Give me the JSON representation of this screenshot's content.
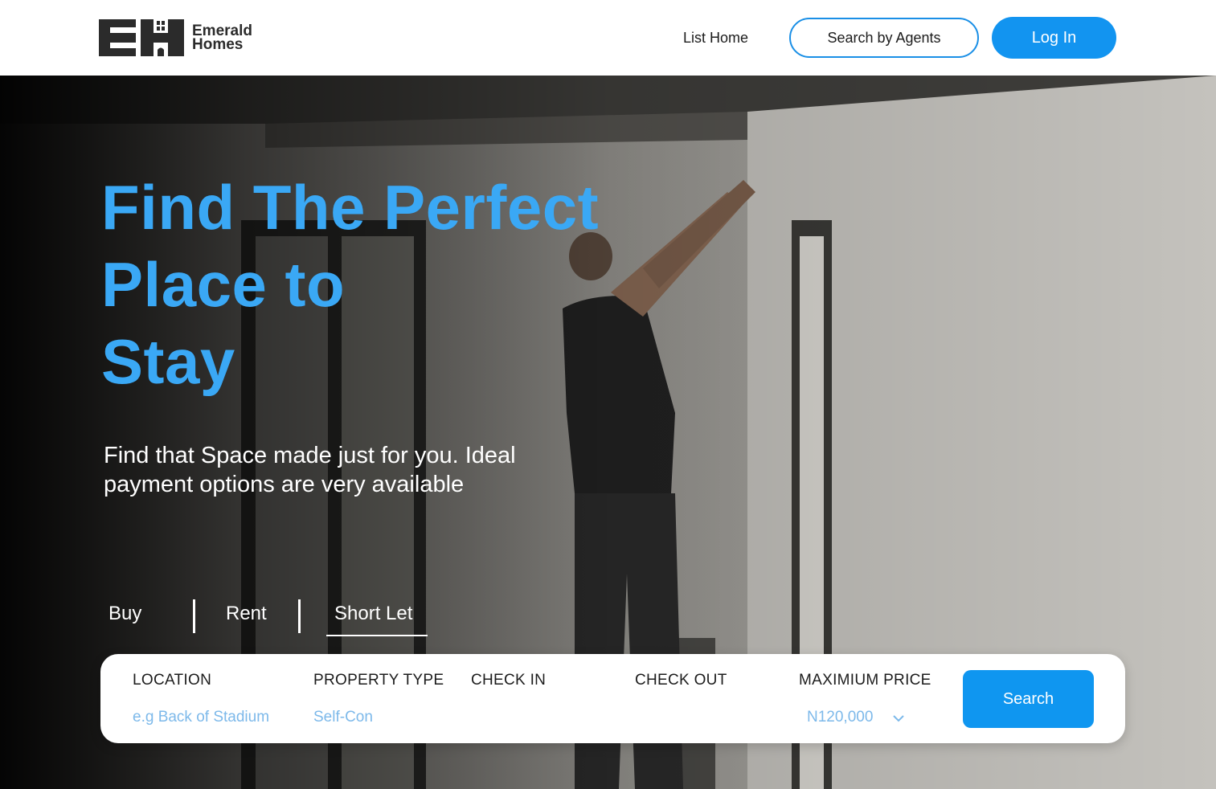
{
  "brand": {
    "name_line1": "Emerald",
    "name_line2": "Homes",
    "mark_letters": "EH"
  },
  "nav": {
    "list_home": "List Home",
    "search_agents": "Search by Agents",
    "login": "Log In"
  },
  "hero": {
    "title_line1": "Find The Perfect",
    "title_line2": "Place to",
    "title_line3": "Stay",
    "subtitle": "Find that Space made just for you. Ideal payment options are very available",
    "title_color": "#3aa8f5"
  },
  "tabs": {
    "buy": "Buy",
    "rent": "Rent",
    "short_let": "Short Let",
    "active": "Short Let"
  },
  "search": {
    "location_label": "LOCATION",
    "location_placeholder": "e.g Back of Stadium",
    "property_type_label": "PROPERTY TYPE",
    "property_type_value": "Self-Con",
    "check_in_label": "CHECK IN",
    "check_out_label": "CHECK OUT",
    "max_price_label": "MAXIMIUM PRICE",
    "max_price_value": "N120,000",
    "button": "Search"
  },
  "colors": {
    "accent": "#1294f0",
    "placeholder": "#7db9ea"
  }
}
